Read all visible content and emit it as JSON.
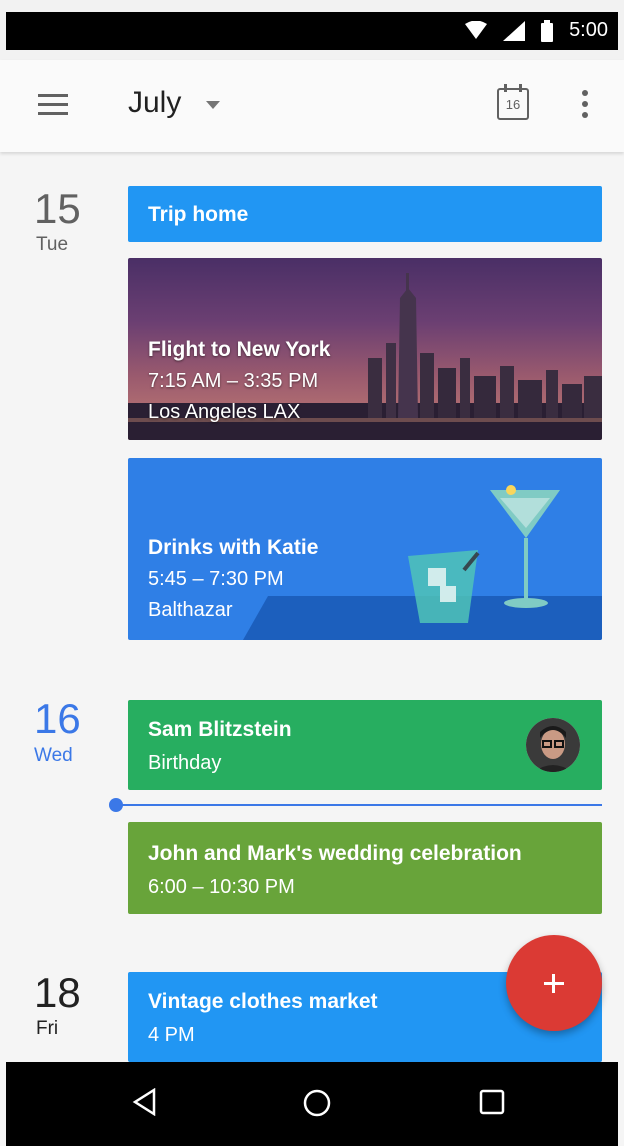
{
  "status_bar": {
    "time": "5:00",
    "icons": [
      "wifi-icon",
      "signal-icon",
      "battery-icon"
    ]
  },
  "app_bar": {
    "month": "July",
    "today_date": "16",
    "icons": [
      "menu-icon",
      "dropdown-caret-icon",
      "calendar-today-icon",
      "overflow-menu-icon"
    ]
  },
  "days": [
    {
      "number": "15",
      "weekday": "Tue",
      "is_today": false,
      "events": [
        {
          "title": "Trip home",
          "color": "#2196f3"
        },
        {
          "title": "Flight to New York",
          "time": "7:15 AM – 3:35 PM",
          "location": "Los Angeles LAX",
          "image": "city-skyline"
        },
        {
          "title": "Drinks with Katie",
          "time": "5:45 – 7:30 PM",
          "location": "Balthazar",
          "image": "cocktail-illustration",
          "color": "#2f7fe6"
        }
      ]
    },
    {
      "number": "16",
      "weekday": "Wed",
      "is_today": true,
      "events": [
        {
          "title": "Sam Blitzstein",
          "subtitle": "Birthday",
          "color": "#27ae60",
          "avatar": true
        },
        {
          "title": "John and Mark's wedding celebration",
          "time": "6:00 – 10:30 PM",
          "color": "#68a43a"
        }
      ]
    },
    {
      "number": "18",
      "weekday": "Fri",
      "is_today": false,
      "events": [
        {
          "title": "Vintage clothes market",
          "time": "4 PM",
          "color": "#2196f3"
        }
      ]
    }
  ],
  "fab": {
    "label": "+",
    "color": "#db3a34"
  },
  "nav_bar": {
    "buttons": [
      "back-icon",
      "home-icon",
      "recents-icon"
    ]
  },
  "colors": {
    "accent": "#3b78e7"
  }
}
